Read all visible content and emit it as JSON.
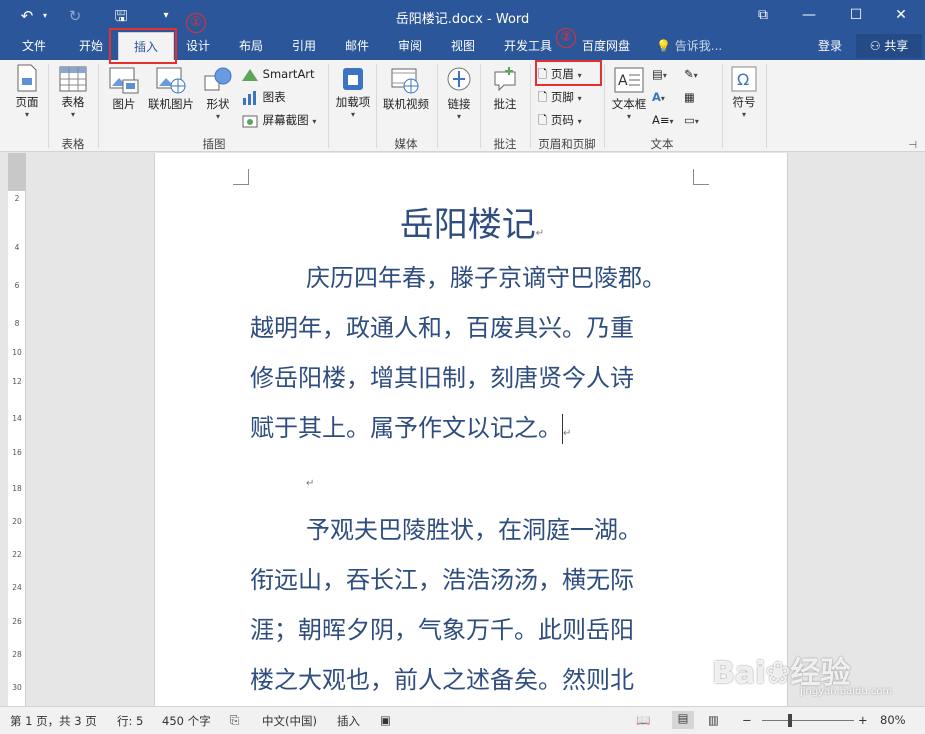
{
  "titlebar": {
    "title": "岳阳楼记.docx - Word",
    "undo_icon": "↶",
    "redo_icon": "↻",
    "save_icon": "🖫",
    "customize_icon": "▾",
    "restore_ribbon_icon": "⧉",
    "minimize_icon": "—",
    "maximize_icon": "☐",
    "close_icon": "✕"
  },
  "tabs": [
    "文件",
    "开始",
    "插入",
    "设计",
    "布局",
    "引用",
    "邮件",
    "审阅",
    "视图",
    "开发工具",
    "百度网盘"
  ],
  "active_tab": "插入",
  "tell_me": "告诉我...",
  "login": "登录",
  "share": "共享",
  "ribbon": {
    "pages": "页面",
    "table": "表格",
    "picture": "图片",
    "online_picture": "联机图片",
    "shapes": "形状",
    "smartart": "SmartArt",
    "chart": "图表",
    "screenshot": "屏幕截图",
    "addins": "加载项",
    "online_video": "联机视频",
    "link": "链接",
    "comment": "批注",
    "header": "页眉",
    "footer": "页脚",
    "page_number": "页码",
    "textbox": "文本框",
    "symbol": "符号"
  },
  "groups": {
    "table": "表格",
    "illustrations": "插图",
    "media": "媒体",
    "comments": "批注",
    "header_footer": "页眉和页脚",
    "text": "文本"
  },
  "annotations": {
    "one": "①",
    "two": "②"
  },
  "ruler_ticks": [
    "2",
    "4",
    "6",
    "8",
    "10",
    "12",
    "14",
    "16",
    "18",
    "20",
    "22",
    "24",
    "26",
    "28",
    "30"
  ],
  "document": {
    "title": "岳阳楼记",
    "para1": [
      "庆历四年春，滕子京谪守巴陵郡。",
      "越明年，政通人和，百废具兴。乃重",
      "修岳阳楼，增其旧制，刻唐贤今人诗",
      "赋于其上。属予作文以记之。"
    ],
    "para2": [
      "予观夫巴陵胜状，在洞庭一湖。",
      "衔远山，吞长江，浩浩汤汤，横无际",
      "涯；朝晖夕阴，气象万千。此则岳阳",
      "楼之大观也，前人之述备矣。然则北"
    ],
    "para_mark": "↵"
  },
  "status": {
    "page": "第 1 页，共 3 页",
    "line": "行: 5",
    "words": "450 个字",
    "language": "中文(中国)",
    "mode": "插入",
    "zoom": "80%",
    "zoom_level": 0.3
  },
  "watermark": {
    "logo": "Bai❀经验",
    "url": "jingyan.baidu.com"
  },
  "colors": {
    "accent": "#2b579a",
    "annotation": "#e53030",
    "doc_text": "#2f4d7e"
  }
}
